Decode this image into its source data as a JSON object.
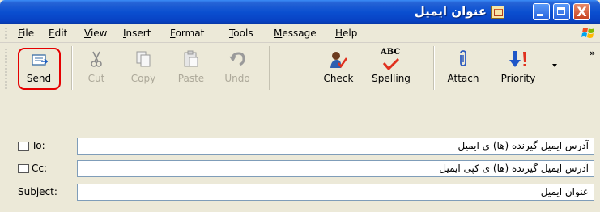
{
  "window": {
    "title": "عنوان ایمیل",
    "controls": {
      "minimize": "minimize",
      "maximize": "maximize",
      "close": "X"
    }
  },
  "menu": {
    "items": [
      {
        "label": "File",
        "accel": "F",
        "rest": "ile"
      },
      {
        "label": "Edit",
        "accel": "E",
        "rest": "dit"
      },
      {
        "label": "View",
        "accel": "V",
        "rest": "iew"
      },
      {
        "label": "Insert",
        "accel": "I",
        "rest": "nsert"
      },
      {
        "label": "Format",
        "accel": "F",
        "rest": "ormat"
      },
      {
        "label": "Tools",
        "accel": "T",
        "rest": "ools"
      },
      {
        "label": "Message",
        "accel": "M",
        "rest": "essage"
      },
      {
        "label": "Help",
        "accel": "H",
        "rest": "elp"
      }
    ]
  },
  "toolbar": {
    "send": "Send",
    "cut": "Cut",
    "copy": "Copy",
    "paste": "Paste",
    "undo": "Undo",
    "check": "Check",
    "spelling": "Spelling",
    "spelling_icon_text": "ABC",
    "attach": "Attach",
    "priority": "Priority",
    "overflow": "»"
  },
  "header": {
    "to_label": "To:",
    "to_value": "آدرس ایمیل گیرنده (ها) ی ایمیل",
    "cc_label": "Cc:",
    "cc_value": "آدرس ایمیل گیرنده (ها) ی کپی ایمیل",
    "subject_label": "Subject:",
    "subject_value": "عنوان ایمیل"
  },
  "colors": {
    "titlebar": "#0a4fd0",
    "chrome": "#ece9d8",
    "send_highlight": "#e60000",
    "disabled_text": "#aca899",
    "field_border": "#7f9db9"
  }
}
